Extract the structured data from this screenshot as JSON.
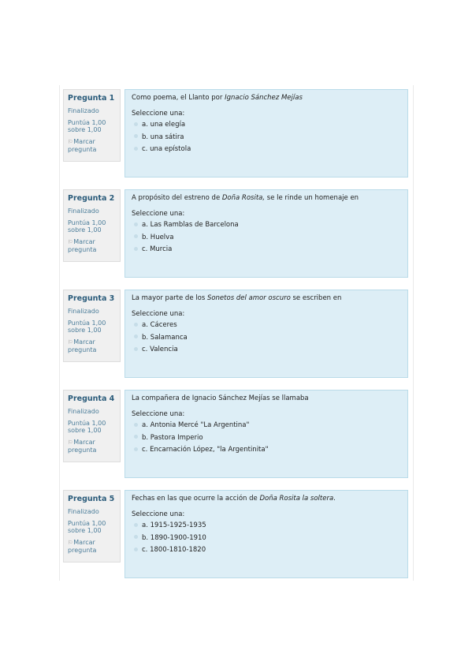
{
  "prompt_label": "Seleccione una:",
  "questions": [
    {
      "number": "Pregunta 1",
      "state": "Finalizado",
      "grade": "Puntúa 1,00 sobre 1,00",
      "flag_label": "Marcar pregunta",
      "text_before": "Como poema, el Llanto por ",
      "text_italic": "Ignacio Sánchez Mejías",
      "text_after": "",
      "answers": [
        "a. una elegía",
        "b. una sátira",
        "c. una epístola"
      ]
    },
    {
      "number": "Pregunta 2",
      "state": "Finalizado",
      "grade": "Puntúa 1,00 sobre 1,00",
      "flag_label": "Marcar pregunta",
      "text_before": "A propósito del estreno de ",
      "text_italic": "Doña Rosita,",
      "text_after": " se le rinde un homenaje en",
      "answers": [
        "a. Las Ramblas de Barcelona",
        "b. Huelva",
        "c. Murcia"
      ]
    },
    {
      "number": "Pregunta 3",
      "state": "Finalizado",
      "grade": "Puntúa 1,00 sobre 1,00",
      "flag_label": "Marcar pregunta",
      "text_before": "La mayor parte de los ",
      "text_italic": "Sonetos del amor oscuro",
      "text_after": " se escriben en",
      "answers": [
        "a. Cáceres",
        "b. Salamanca",
        "c. Valencia"
      ]
    },
    {
      "number": "Pregunta 4",
      "state": "Finalizado",
      "grade": "Puntúa 1,00 sobre 1,00",
      "flag_label": "Marcar pregunta",
      "text_before": "La compañera de Ignacio Sánchez Mejías se llamaba",
      "text_italic": "",
      "text_after": "",
      "answers": [
        "a. Antonia Mercé \"La Argentina\"",
        "b. Pastora Imperio",
        "c. Encarnación López, \"la Argentinita\""
      ]
    },
    {
      "number": "Pregunta 5",
      "state": "Finalizado",
      "grade": "Puntúa 1,00 sobre 1,00",
      "flag_label": "Marcar pregunta",
      "text_before": "Fechas en las que ocurre la acción de ",
      "text_italic": "Doña Rosita la soltera",
      "text_after": ".",
      "answers": [
        "a. 1915-1925-1935",
        "b. 1890-1900-1910",
        "c. 1800-1810-1820"
      ]
    }
  ]
}
